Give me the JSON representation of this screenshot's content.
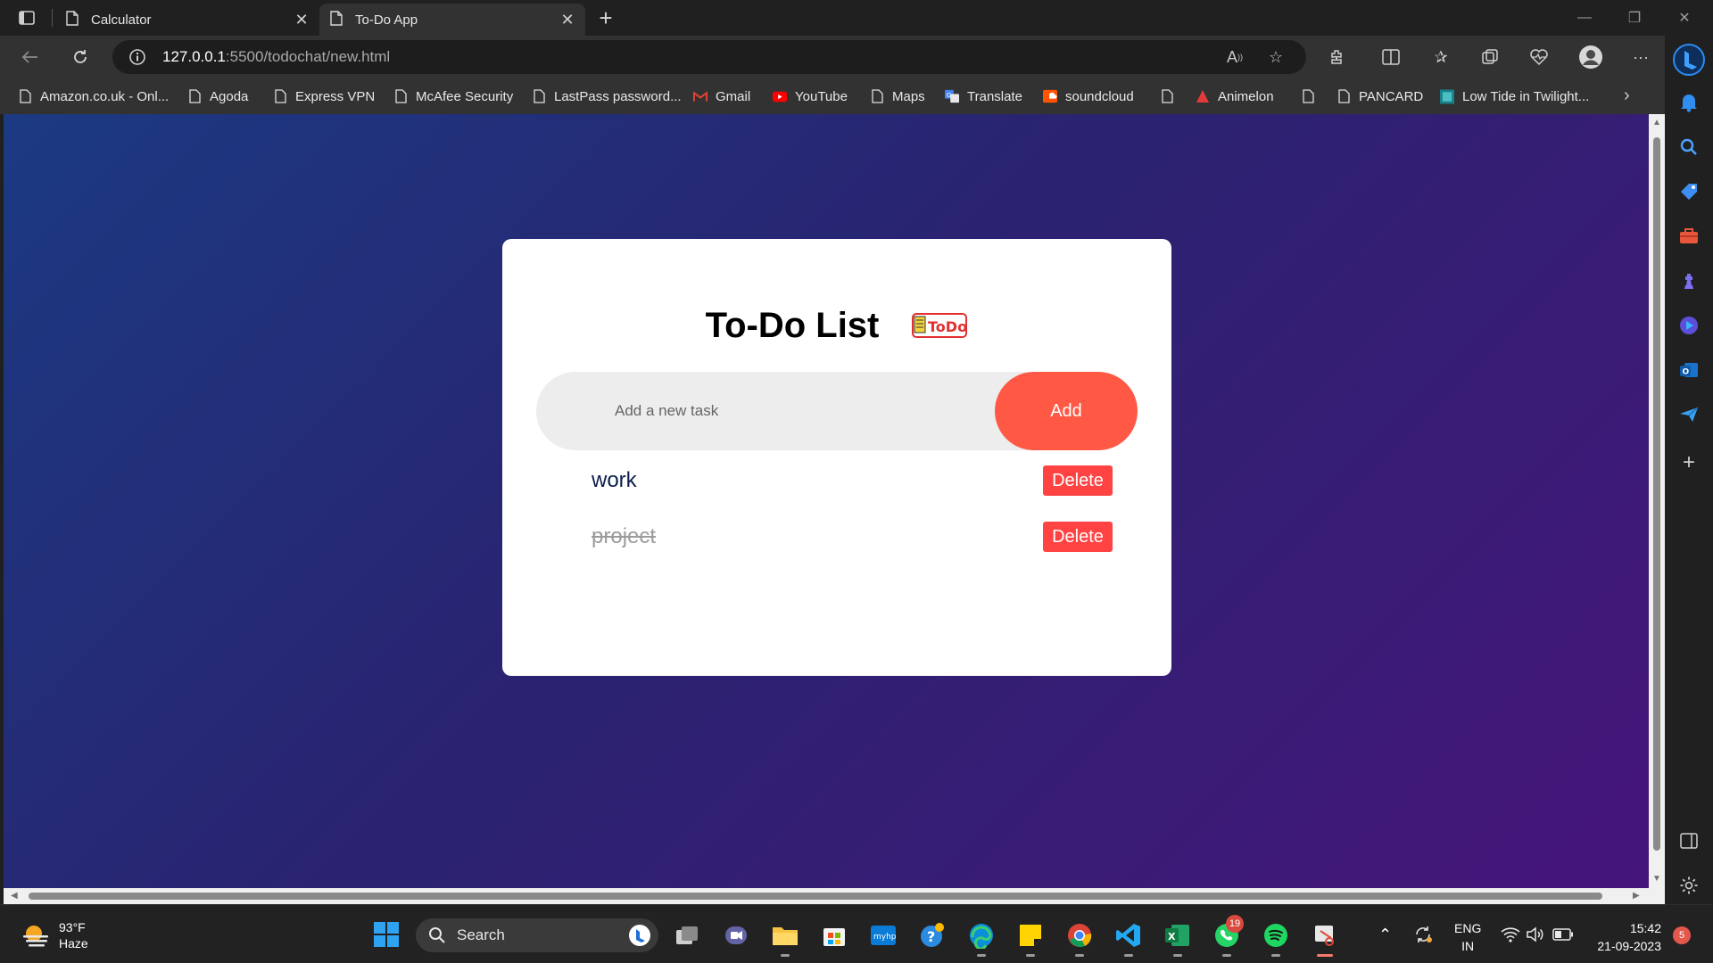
{
  "browser": {
    "tabs": [
      {
        "title": "Calculator"
      },
      {
        "title": "To-Do App"
      }
    ],
    "address": {
      "host": "127.0.0.1",
      "path": ":5500/todochat/new.html"
    },
    "bookmarks": [
      {
        "label": "Amazon.co.uk - Onl...",
        "icon": "page-icon"
      },
      {
        "label": "Agoda",
        "icon": "page-icon"
      },
      {
        "label": "Express VPN",
        "icon": "page-icon"
      },
      {
        "label": "McAfee Security",
        "icon": "page-icon"
      },
      {
        "label": "LastPass password...",
        "icon": "page-icon"
      },
      {
        "label": "Gmail",
        "icon": "gmail-icon"
      },
      {
        "label": "YouTube",
        "icon": "youtube-icon"
      },
      {
        "label": "Maps",
        "icon": "page-icon"
      },
      {
        "label": "Translate",
        "icon": "translate-icon"
      },
      {
        "label": "soundcloud",
        "icon": "soundcloud-icon"
      },
      {
        "label": "",
        "icon": "page-icon"
      },
      {
        "label": "Animelon",
        "icon": "animelon-icon"
      },
      {
        "label": "",
        "icon": "page-icon"
      },
      {
        "label": "PANCARD",
        "icon": "page-icon"
      },
      {
        "label": "Low Tide in Twilight...",
        "icon": "twilight-icon"
      }
    ]
  },
  "app": {
    "title": "To-Do List",
    "logo_text": "ToDo",
    "input": {
      "placeholder": "Add a new task",
      "value": ""
    },
    "add_label": "Add",
    "tasks": [
      {
        "text": "work",
        "completed": false,
        "delete_label": "Delete"
      },
      {
        "text": "project",
        "completed": true,
        "delete_label": "Delete"
      }
    ],
    "colors": {
      "accent": "#ff5945",
      "delete": "#ff4242",
      "task_text": "#0b1e4d",
      "gradient_start": "#1b3a82",
      "gradient_end": "#46157a"
    }
  },
  "taskbar": {
    "weather": {
      "temp": "93°F",
      "condition": "Haze"
    },
    "search_label": "Search",
    "whatsapp_badge": "19",
    "language": {
      "line1": "ENG",
      "line2": "IN"
    },
    "clock": {
      "time": "15:42",
      "date": "21-09-2023"
    },
    "notification_count": "5"
  }
}
